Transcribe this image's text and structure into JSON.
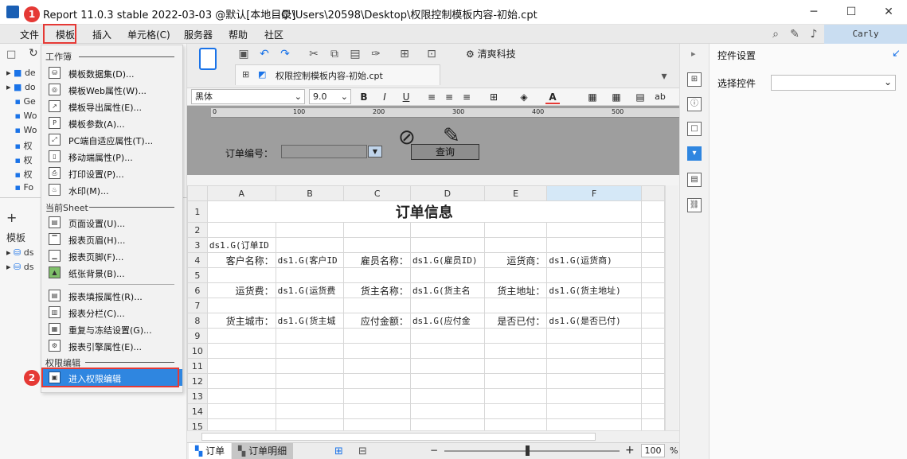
{
  "window": {
    "title": "Report 11.0.3 stable 2022-03-03 @默认[本地目录]",
    "path": "C:\\Users\\20598\\Desktop\\权限控制模板内容-初始.cpt",
    "minimize": "─",
    "maximize": "☐",
    "close": "✕"
  },
  "menu": {
    "items": [
      "文件",
      "模板",
      "插入",
      "单元格(C)",
      "服务器",
      "帮助",
      "社区"
    ]
  },
  "user": {
    "name": "Carly"
  },
  "steps": {
    "one": "1",
    "two": "2"
  },
  "dropdown": {
    "sec_workbook": "工作簿",
    "workbook_items": [
      {
        "label": "模板数据集(D)...",
        "icon": "database-icon"
      },
      {
        "label": "模板Web属性(W)...",
        "icon": "globe-icon"
      },
      {
        "label": "模板导出属性(E)...",
        "icon": "export-icon"
      },
      {
        "label": "模板参数(A)...",
        "icon": "parameter-icon"
      },
      {
        "label": "PC端自适应属性(T)...",
        "icon": "adaptive-icon"
      },
      {
        "label": "移动端属性(P)...",
        "icon": "mobile-icon"
      },
      {
        "label": "打印设置(P)...",
        "icon": "printer-icon"
      },
      {
        "label": "水印(M)...",
        "icon": "watermark-icon"
      }
    ],
    "sec_sheet": "当前Sheet",
    "sheet_items": [
      {
        "label": "页面设置(U)...",
        "icon": "page-setup-icon"
      },
      {
        "label": "报表页眉(H)...",
        "icon": "header-icon"
      },
      {
        "label": "报表页脚(F)...",
        "icon": "footer-icon"
      },
      {
        "label": "纸张背景(B)...",
        "icon": "background-icon"
      },
      {
        "label": "报表填报属性(R)...",
        "icon": "fill-icon"
      },
      {
        "label": "报表分栏(C)...",
        "icon": "columns-icon"
      },
      {
        "label": "重复与冻结设置(G)...",
        "icon": "freeze-icon"
      },
      {
        "label": "报表引擎属性(E)...",
        "icon": "engine-icon"
      }
    ],
    "sec_permission": "权限编辑",
    "enter_permission": "进入权限编辑"
  },
  "tree": {
    "items": [
      "de",
      "do",
      "Ge",
      "Wo",
      "Wo",
      "权",
      "权",
      "权",
      "Fo"
    ],
    "section2": "模板",
    "ds_items": [
      "ds",
      "ds"
    ]
  },
  "toolbar": {
    "company": "清爽科技",
    "file_tab": "权限控制模板内容-初始.cpt"
  },
  "format": {
    "font": "黑体",
    "size": "9.0",
    "bold": "B",
    "italic": "I",
    "underline": "U",
    "font_color": "A",
    "wrap": "ab"
  },
  "param": {
    "ruler_labels": [
      "0",
      "100",
      "200",
      "300",
      "400",
      "500"
    ],
    "label": "订单编号：",
    "query": "查询"
  },
  "grid": {
    "columns": [
      "A",
      "B",
      "C",
      "D",
      "E",
      "F"
    ],
    "rows": [
      "1",
      "2",
      "3",
      "4",
      "5",
      "6",
      "7",
      "8",
      "9",
      "10",
      "11",
      "12",
      "13",
      "14",
      "15"
    ],
    "title": "订单信息",
    "r3": [
      "ds1.G(订单ID"
    ],
    "r4": [
      "客户名称：",
      "ds1.G(客户ID",
      "雇员名称：",
      "ds1.G(雇员ID)",
      "运货商：",
      "ds1.G(运货商)"
    ],
    "r6": [
      "运货费：",
      "ds1.G(运货费",
      "货主名称：",
      "ds1.G(货主名",
      "货主地址：",
      "ds1.G(货主地址)"
    ],
    "r8": [
      "货主城市：",
      "ds1.G(货主城",
      "应付金额：",
      "ds1.G(应付金",
      "是否已付：",
      "ds1.G(是否已付)"
    ]
  },
  "sheets": [
    "订单",
    "订单明细"
  ],
  "zoom": {
    "value": "100",
    "unit": "%"
  },
  "right_panel": {
    "title": "控件设置",
    "select_label": "选择控件",
    "select_value": ""
  }
}
